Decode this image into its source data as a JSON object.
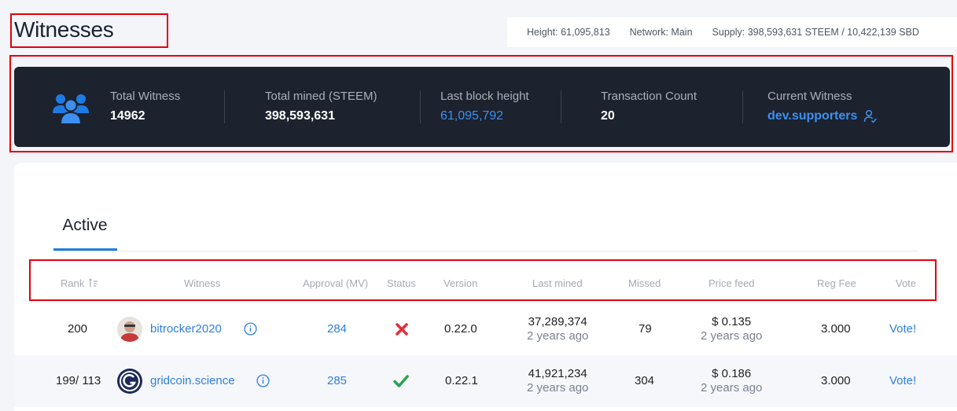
{
  "header": {
    "title": "Witnesses",
    "height": "Height: 61,095,813",
    "network": "Network: Main",
    "supply": "Supply: 398,593,631 STEEM / 10,422,139 SBD"
  },
  "stats": {
    "total_witness_label": "Total Witness",
    "total_witness_value": "14962",
    "total_mined_label": "Total mined (STEEM)",
    "total_mined_value": "398,593,631",
    "last_block_label": "Last block height",
    "last_block_value": "61,095,792",
    "tx_count_label": "Transaction Count",
    "tx_count_value": "20",
    "current_witness_label": "Current Witness",
    "current_witness_value": "dev.supporters"
  },
  "tabs": {
    "active": "Active"
  },
  "columns": {
    "rank": "Rank",
    "witness": "Witness",
    "approval": "Approval (MV)",
    "status": "Status",
    "version": "Version",
    "last_mined": "Last mined",
    "missed": "Missed",
    "price_feed": "Price feed",
    "reg_fee": "Reg Fee",
    "vote": "Vote"
  },
  "rows": [
    {
      "rank": "200",
      "witness": "bitrocker2020",
      "approval": "284",
      "status": "disabled",
      "version": "0.22.0",
      "last_mined_block": "37,289,374",
      "last_mined_ago": "2 years ago",
      "missed": "79",
      "price_feed": "$ 0.135",
      "price_feed_ago": "2 years ago",
      "reg_fee": "3.000",
      "vote": "Vote!"
    },
    {
      "rank": "199/ 113",
      "witness": "gridcoin.science",
      "approval": "285",
      "status": "active",
      "version": "0.22.1",
      "last_mined_block": "41,921,234",
      "last_mined_ago": "2 years ago",
      "missed": "304",
      "price_feed": "$ 0.186",
      "price_feed_ago": "2 years ago",
      "reg_fee": "3.000",
      "vote": "Vote!"
    }
  ],
  "colors": {
    "accent": "#2f7fe0",
    "panel": "#1c222e",
    "annotation": "#e3000f",
    "cross": "#e0303a",
    "check": "#2ea44f"
  }
}
